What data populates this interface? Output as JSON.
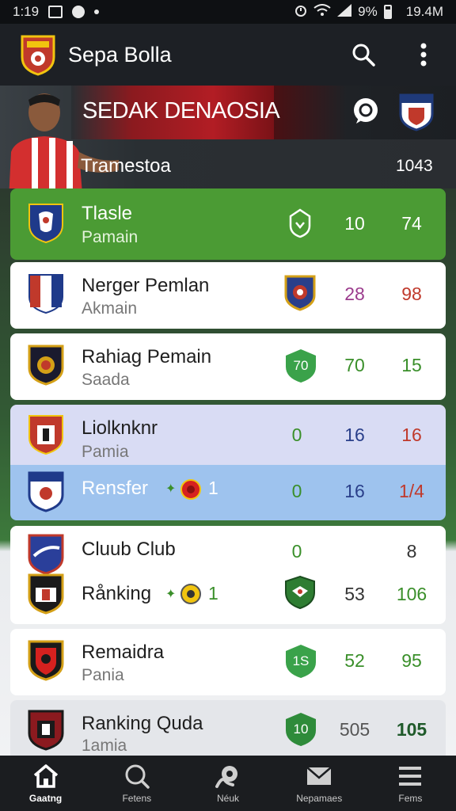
{
  "status_bar": {
    "time": "1:19",
    "battery": "9%",
    "clock_right": "19.4M"
  },
  "app_bar": {
    "title": "Sepa Bolla",
    "search_icon": "search-icon",
    "more_icon": "more-vertical-icon"
  },
  "hero": {
    "title": "SEDAK DENAOSIA",
    "subtitle": "Tramestoa",
    "count": "1043"
  },
  "rows": [
    {
      "name": "Tlasle",
      "sub": "Pamain",
      "stat1": "10",
      "stat2": "74",
      "style": "green"
    },
    {
      "name": "Nerger Pemlan",
      "sub": "Akmain",
      "stat1": "28",
      "stat2": "98",
      "style": "white"
    },
    {
      "name": "Rahiag Pemain",
      "sub": "Saada",
      "shield": "70",
      "stat1": "70",
      "stat2": "15",
      "style": "white"
    },
    {
      "name": "Liolknknr",
      "sub": "Pamia",
      "stat0": "0",
      "stat1": "16",
      "stat2": "16",
      "style": "lavender"
    },
    {
      "name": "Rensfer",
      "extra": "1",
      "stat0": "0",
      "stat1": "16",
      "stat2": "1/4",
      "style": "blue"
    },
    {
      "name": "Cluub Club",
      "stat0": "0",
      "stat2": "8",
      "style": "white"
    },
    {
      "name": "Rånking",
      "extra": "1",
      "stat1": "53",
      "stat2": "106",
      "style": "white"
    },
    {
      "name": "Remaidra",
      "sub": "Pania",
      "shield": "1S",
      "stat1": "52",
      "stat2": "95",
      "style": "white"
    },
    {
      "name": "Ranking Quda",
      "sub": "1amia",
      "shield": "10",
      "stat1": "505",
      "stat2": "105",
      "style": "white"
    }
  ],
  "colors": {
    "accent_green": "#4b9b34",
    "purple_stat": "#9b3b8d",
    "red_stat": "#c0392b",
    "blue_stat": "#2a3f8a",
    "green_stat": "#3a8f2a"
  },
  "nav": {
    "items": [
      {
        "label": "Gaatng",
        "icon": "home-icon"
      },
      {
        "label": "Fetens",
        "icon": "search-icon"
      },
      {
        "label": "Néuk",
        "icon": "ball-icon"
      },
      {
        "label": "Nepamaes",
        "icon": "mail-icon"
      },
      {
        "label": "Fems",
        "icon": "menu-icon"
      }
    ]
  }
}
